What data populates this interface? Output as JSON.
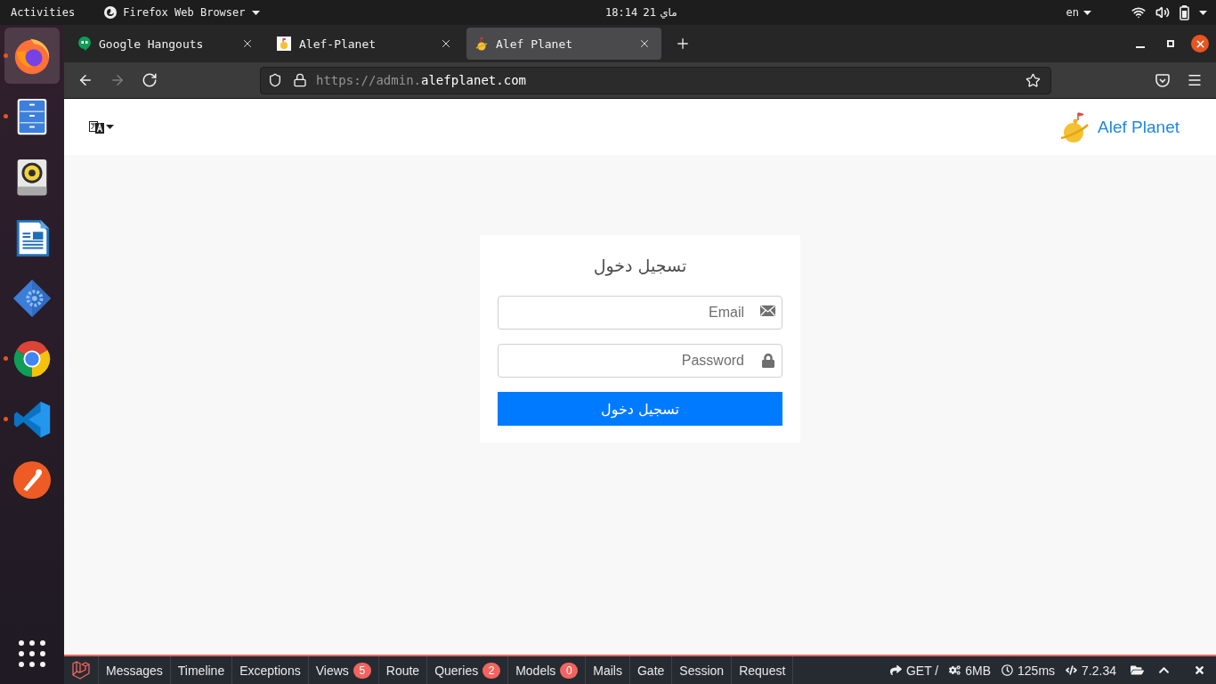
{
  "top_bar": {
    "activities": "Activities",
    "app_menu": "Firefox Web Browser",
    "time": "18:14",
    "date": "ماي 21",
    "keyboard_layout": "en"
  },
  "dock": [
    {
      "kind": "fox",
      "running": true,
      "selected": true
    },
    {
      "kind": "cabinet",
      "running": true,
      "selected": false
    },
    {
      "kind": "speaker",
      "running": false,
      "selected": false
    },
    {
      "kind": "document",
      "running": false,
      "selected": false
    },
    {
      "kind": "gear",
      "running": false,
      "selected": false
    },
    {
      "kind": "wheel",
      "running": true,
      "selected": false
    },
    {
      "kind": "ribbon",
      "running": true,
      "selected": false
    },
    {
      "kind": "pen",
      "running": false,
      "selected": false
    }
  ],
  "tabs": [
    {
      "title": "Google Hangouts",
      "kind": "chat",
      "selected": false
    },
    {
      "title": "Alef-Planet",
      "kind": "planet-tile",
      "selected": false
    },
    {
      "title": "Alef Planet",
      "kind": "planet",
      "selected": true
    }
  ],
  "nav_buttons": [
    {
      "kind": "back",
      "disabled": false
    },
    {
      "kind": "forward",
      "disabled": true
    },
    {
      "kind": "reload",
      "disabled": false
    }
  ],
  "address": {
    "parts": [
      {
        "text": "https://admin.",
        "highlight": false
      },
      {
        "text": "alefplanet.com",
        "highlight": true
      }
    ]
  },
  "header": {
    "brand": "Alef Planet"
  },
  "login": {
    "title": "تسجيل دخول",
    "fields": [
      {
        "kind": "email",
        "placeholder": "Email"
      },
      {
        "kind": "password",
        "placeholder": "Password"
      }
    ],
    "submit": "تسجيل دخول"
  },
  "debug_bar": {
    "items": [
      {
        "label": "Messages"
      },
      {
        "label": "Timeline"
      },
      {
        "label": "Exceptions"
      },
      {
        "label": "Views",
        "count": "5"
      },
      {
        "label": "Route"
      },
      {
        "label": "Queries",
        "count": "2"
      },
      {
        "label": "Models",
        "count": "0"
      },
      {
        "label": "Mails"
      },
      {
        "label": "Gate"
      },
      {
        "label": "Session"
      },
      {
        "label": "Request"
      }
    ],
    "stats": [
      {
        "kind": "request",
        "text": "GET /"
      },
      {
        "kind": "memory",
        "text": "6MB"
      },
      {
        "kind": "duration",
        "text": "125ms"
      },
      {
        "kind": "version",
        "text": "7.2.34"
      }
    ]
  }
}
